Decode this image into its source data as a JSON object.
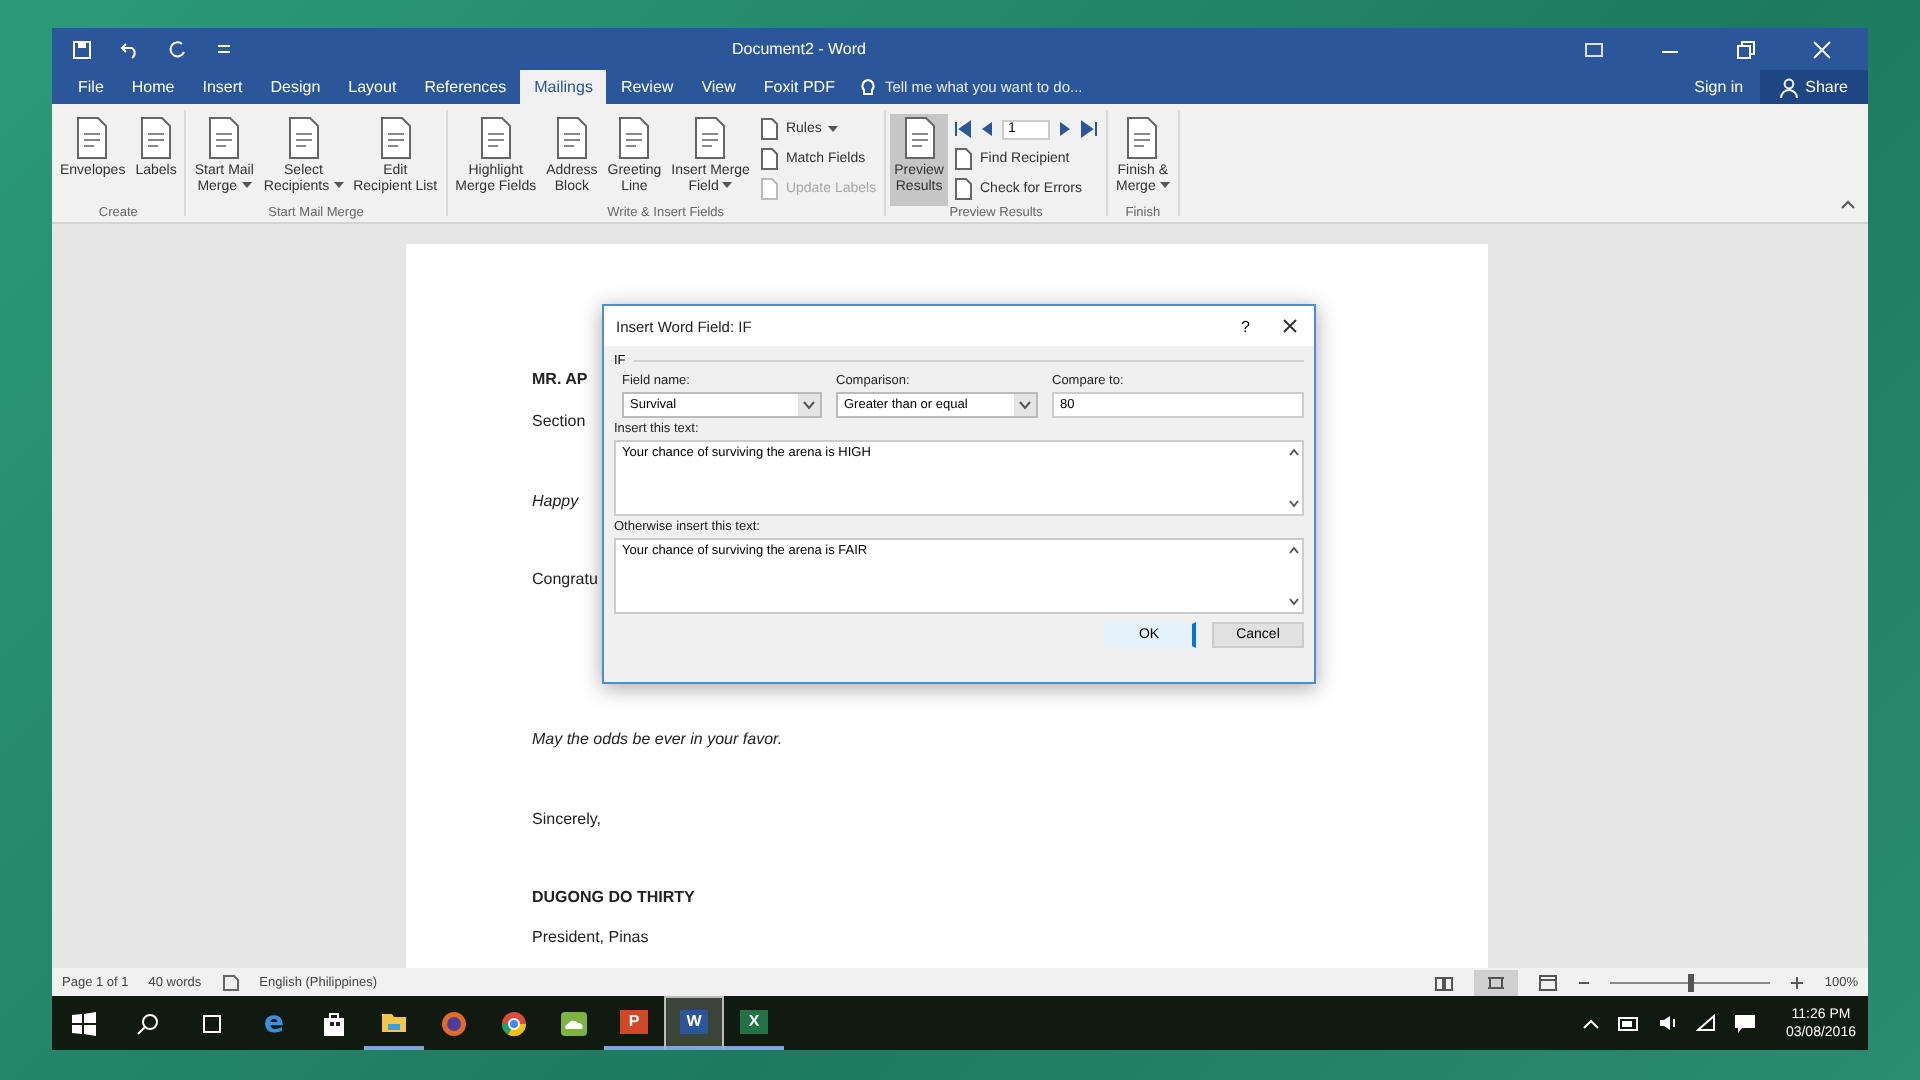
{
  "window": {
    "title": "Document2 - Word"
  },
  "tabs": [
    {
      "label": "File",
      "selected": false
    },
    {
      "label": "Home",
      "selected": false
    },
    {
      "label": "Insert",
      "selected": false
    },
    {
      "label": "Design",
      "selected": false
    },
    {
      "label": "Layout",
      "selected": false
    },
    {
      "label": "References",
      "selected": false
    },
    {
      "label": "Mailings",
      "selected": true
    },
    {
      "label": "Review",
      "selected": false
    },
    {
      "label": "View",
      "selected": false
    },
    {
      "label": "Foxit PDF",
      "selected": false
    }
  ],
  "tell_me": {
    "placeholder": "Tell me what you want to do..."
  },
  "account": {
    "sign_in": "Sign in",
    "share": "Share"
  },
  "ribbon": {
    "groups": [
      {
        "label": "Create",
        "items": [
          {
            "kind": "large",
            "label": "Envelopes",
            "dropdown": false,
            "pressed": false
          },
          {
            "kind": "large",
            "label": "Labels",
            "dropdown": false,
            "pressed": false
          }
        ]
      },
      {
        "label": "Start Mail Merge",
        "items": [
          {
            "kind": "large",
            "label": "Start Mail\nMerge",
            "dropdown": true,
            "pressed": false
          },
          {
            "kind": "large",
            "label": "Select\nRecipients",
            "dropdown": true,
            "pressed": false
          },
          {
            "kind": "large",
            "label": "Edit\nRecipient List",
            "dropdown": false,
            "pressed": false
          }
        ]
      },
      {
        "label": "Write & Insert Fields",
        "items": [
          {
            "kind": "large",
            "label": "Highlight\nMerge Fields",
            "dropdown": false,
            "pressed": false
          },
          {
            "kind": "large",
            "label": "Address\nBlock",
            "dropdown": false,
            "pressed": false
          },
          {
            "kind": "large",
            "label": "Greeting\nLine",
            "dropdown": false,
            "pressed": false
          },
          {
            "kind": "large",
            "label": "Insert Merge\nField",
            "dropdown": true,
            "pressed": false
          },
          {
            "kind": "stack",
            "items": [
              {
                "kind": "small",
                "label": "Rules",
                "dropdown": true,
                "disabled": false
              },
              {
                "kind": "small",
                "label": "Match Fields",
                "dropdown": false,
                "disabled": false
              },
              {
                "kind": "small",
                "label": "Update Labels",
                "dropdown": false,
                "disabled": true
              }
            ]
          }
        ]
      },
      {
        "label": "Preview Results",
        "items": [
          {
            "kind": "large",
            "label": "Preview\nResults",
            "dropdown": false,
            "pressed": true
          },
          {
            "kind": "stack",
            "items": [
              {
                "kind": "nav",
                "record": "1"
              },
              {
                "kind": "small",
                "label": "Find Recipient",
                "dropdown": false,
                "disabled": false
              },
              {
                "kind": "small",
                "label": "Check for Errors",
                "dropdown": false,
                "disabled": false
              }
            ]
          }
        ]
      },
      {
        "label": "Finish",
        "items": [
          {
            "kind": "large",
            "label": "Finish &\nMerge",
            "dropdown": true,
            "pressed": false
          }
        ]
      }
    ]
  },
  "document": {
    "paragraphs": [
      {
        "kind": "bold",
        "text": "MR. AP"
      },
      {
        "kind": "normal",
        "text": "Section"
      },
      {
        "kind": "italic",
        "text": "Happy"
      },
      {
        "kind": "normal",
        "text": "Congratu"
      },
      {
        "kind": "italic",
        "text": "May the odds be ever in your favor."
      },
      {
        "kind": "normal",
        "text": "Sincerely,"
      },
      {
        "kind": "bold",
        "text": "DUGONG DO THIRTY"
      },
      {
        "kind": "normal",
        "text": "President, Pinas"
      }
    ]
  },
  "dialog": {
    "title": "Insert Word Field: IF",
    "help": "?",
    "group": "IF",
    "field_name": {
      "label": "Field name:",
      "value": "Survival"
    },
    "comparison": {
      "label": "Comparison:",
      "value": "Greater than or equal"
    },
    "compare_to": {
      "label": "Compare to:",
      "value": "80"
    },
    "insert_text": {
      "label": "Insert this text:",
      "value": "Your chance of surviving the arena is HIGH"
    },
    "otherwise_text": {
      "label": "Otherwise insert this text:",
      "value": "Your chance of surviving the arena is FAIR"
    },
    "buttons": [
      "OK",
      "Cancel"
    ]
  },
  "status_bar": {
    "page": "Page 1 of 1",
    "words": "40 words",
    "language": "English (Philippines)",
    "zoom": {
      "level": 0.5
    },
    "zoom_label": "100%"
  },
  "taskbar": {
    "apps": [
      {
        "kind": "edge",
        "glyph": "e",
        "open": false,
        "selected": false
      },
      {
        "kind": "store",
        "open": false,
        "selected": false
      },
      {
        "kind": "folder",
        "open": true,
        "selected": false
      },
      {
        "kind": "firefox",
        "open": false,
        "selected": false
      },
      {
        "kind": "chrome",
        "open": false,
        "selected": false
      },
      {
        "kind": "cloud",
        "open": false,
        "selected": false
      },
      {
        "kind": "powerpoint",
        "glyph": "P",
        "open": true,
        "selected": false
      },
      {
        "kind": "word",
        "glyph": "W",
        "open": true,
        "selected": true
      },
      {
        "kind": "excel",
        "glyph": "X",
        "open": true,
        "selected": false
      }
    ],
    "time": "11:26 PM",
    "date": "03/08/2016"
  }
}
